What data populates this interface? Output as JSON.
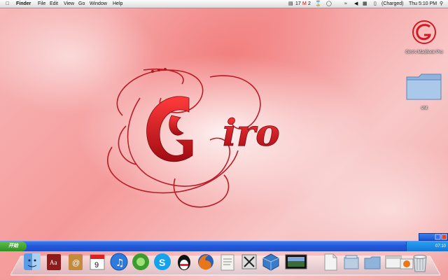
{
  "menubar": {
    "apple_icon": "apple-icon",
    "items": [
      {
        "label": "Finder",
        "bold": true
      },
      {
        "label": "File"
      },
      {
        "label": "Edit"
      },
      {
        "label": "View"
      },
      {
        "label": "Go"
      },
      {
        "label": "Window"
      },
      {
        "label": "Help"
      }
    ],
    "status": {
      "calendar_count": "17",
      "mail_count": "2",
      "battery": "(Charged)",
      "clock": "Thu 5:10 PM"
    }
  },
  "wallpaper": {
    "text": "Giro",
    "color": "#c8141e"
  },
  "desktop_icons": [
    {
      "label": "Giro's MacBook Pro",
      "icon": "giro-logo-icon"
    },
    {
      "label": "shit",
      "icon": "folder-icon"
    }
  ],
  "xp_taskbar": {
    "start_label": "开始",
    "clock": "07:10"
  },
  "dock": [
    {
      "name": "finder",
      "icon": "finder-icon"
    },
    {
      "name": "dictionary",
      "icon": "dictionary-icon"
    },
    {
      "name": "address-book",
      "icon": "address-book-icon"
    },
    {
      "name": "ical",
      "icon": "calendar-icon",
      "date": "9"
    },
    {
      "name": "itunes",
      "icon": "itunes-icon"
    },
    {
      "name": "grapher",
      "icon": "green-gear-icon"
    },
    {
      "name": "skype",
      "icon": "skype-icon"
    },
    {
      "name": "qq",
      "icon": "penguin-icon"
    },
    {
      "name": "firefox",
      "icon": "firefox-icon"
    },
    {
      "name": "text-edit",
      "icon": "notepad-icon"
    },
    {
      "name": "x11",
      "icon": "x11-icon"
    },
    {
      "name": "virtualbox",
      "icon": "virtualbox-icon"
    },
    {
      "name": "screen",
      "icon": "screen-icon"
    },
    {
      "name": "document",
      "icon": "document-icon"
    },
    {
      "name": "applications-stack",
      "icon": "stack-icon"
    },
    {
      "name": "downloads-stack",
      "icon": "folder-stack-icon"
    },
    {
      "name": "window-stack",
      "icon": "window-icon"
    },
    {
      "name": "firefox-mini",
      "icon": "firefox-mini-icon"
    },
    {
      "name": "trash",
      "icon": "trash-icon"
    }
  ]
}
